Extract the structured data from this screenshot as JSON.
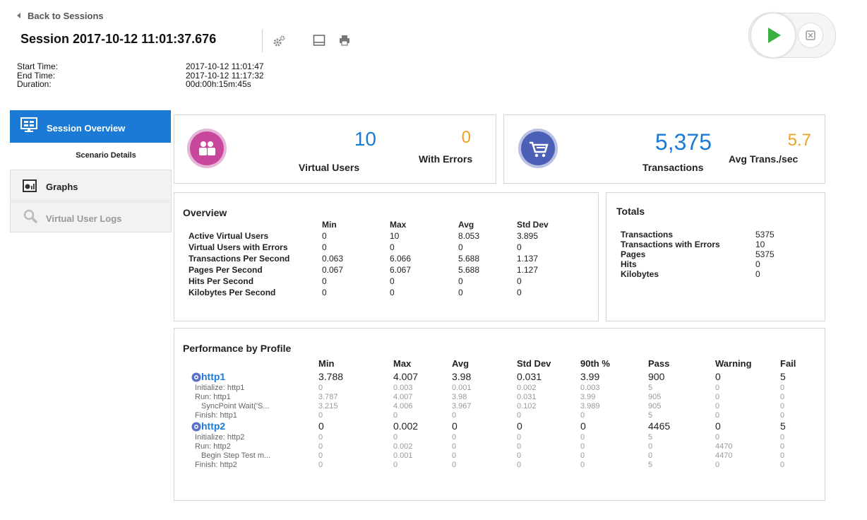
{
  "header": {
    "back_label": "Back to Sessions",
    "title": "Session 2017-10-12 11:01:37.676",
    "meta_labels": [
      "Start Time:",
      "End Time:",
      "Duration:"
    ],
    "meta_values": [
      "2017-10-12 11:01:47",
      "2017-10-12 11:17:32",
      "00d:00h:15m:45s"
    ]
  },
  "nav": {
    "session_overview": "Session Overview",
    "scenario_details": "Scenario Details",
    "graphs": "Graphs",
    "virtual_user_logs": "Virtual User Logs"
  },
  "kpi": {
    "virtual_users_value": "10",
    "virtual_users_label": "Virtual Users",
    "with_errors_value": "0",
    "with_errors_label": "With Errors",
    "transactions_value": "5,375",
    "transactions_label": "Transactions",
    "avg_trans_value": "5.7",
    "avg_trans_label": "Avg Trans./sec"
  },
  "overview": {
    "title": "Overview",
    "headers": [
      "Min",
      "Max",
      "Avg",
      "Std Dev"
    ],
    "rows": [
      {
        "label": "Active Virtual Users",
        "vals": [
          "0",
          "10",
          "8.053",
          "3.895"
        ]
      },
      {
        "label": "Virtual Users with Errors",
        "vals": [
          "0",
          "0",
          "0",
          "0"
        ]
      },
      {
        "label": "Transactions Per Second",
        "vals": [
          "0.063",
          "6.066",
          "5.688",
          "1.137"
        ]
      },
      {
        "label": "Pages Per Second",
        "vals": [
          "0.067",
          "6.067",
          "5.688",
          "1.127"
        ]
      },
      {
        "label": "Hits Per Second",
        "vals": [
          "0",
          "0",
          "0",
          "0"
        ]
      },
      {
        "label": "Kilobytes Per Second",
        "vals": [
          "0",
          "0",
          "0",
          "0"
        ]
      }
    ]
  },
  "totals": {
    "title": "Totals",
    "rows": [
      {
        "label": "Transactions",
        "value": "5375"
      },
      {
        "label": "Transactions with Errors",
        "value": "10"
      },
      {
        "label": "Pages",
        "value": "5375"
      },
      {
        "label": "Hits",
        "value": "0"
      },
      {
        "label": "Kilobytes",
        "value": "0"
      }
    ]
  },
  "performance": {
    "title": "Performance by Profile",
    "headers": [
      "Min",
      "Max",
      "Avg",
      "Std Dev",
      "90th %",
      "Pass",
      "Warning",
      "Fail"
    ],
    "rows": [
      {
        "kind": "profile",
        "label": "http1",
        "vals": [
          "3.788",
          "4.007",
          "3.98",
          "0.031",
          "3.99",
          "900",
          "0",
          "5"
        ]
      },
      {
        "kind": "sub",
        "label": "Initialize: http1",
        "vals": [
          "0",
          "0.003",
          "0.001",
          "0.002",
          "0.003",
          "5",
          "0",
          "0"
        ]
      },
      {
        "kind": "sub",
        "label": "Run: http1",
        "vals": [
          "3.787",
          "4.007",
          "3.98",
          "0.031",
          "3.99",
          "905",
          "0",
          "0"
        ]
      },
      {
        "kind": "subsub",
        "label": "SyncPoint Wait('S...",
        "vals": [
          "3.215",
          "4.006",
          "3.967",
          "0.102",
          "3.989",
          "905",
          "0",
          "0"
        ]
      },
      {
        "kind": "sub",
        "label": "Finish: http1",
        "vals": [
          "0",
          "0",
          "0",
          "0",
          "0",
          "5",
          "0",
          "0"
        ]
      },
      {
        "kind": "profile",
        "label": "http2",
        "vals": [
          "0",
          "0.002",
          "0",
          "0",
          "0",
          "4465",
          "0",
          "5"
        ]
      },
      {
        "kind": "sub",
        "label": "Initialize: http2",
        "vals": [
          "0",
          "0",
          "0",
          "0",
          "0",
          "5",
          "0",
          "0"
        ]
      },
      {
        "kind": "sub",
        "label": "Run: http2",
        "vals": [
          "0",
          "0.002",
          "0",
          "0",
          "0",
          "0",
          "4470",
          "0"
        ]
      },
      {
        "kind": "subsub",
        "label": "Begin Step Test m...",
        "vals": [
          "0",
          "0.001",
          "0",
          "0",
          "0",
          "0",
          "4470",
          "0"
        ]
      },
      {
        "kind": "sub",
        "label": "Finish: http2",
        "vals": [
          "0",
          "0",
          "0",
          "0",
          "0",
          "5",
          "0",
          "0"
        ]
      }
    ]
  },
  "colors": {
    "accent": "#1a7ad6",
    "orange": "#f0a020",
    "users_icon": "#c8479c",
    "cart_icon": "#4a5fb5",
    "play": "#3cb043"
  },
  "icons": [
    "back-arrow-icon",
    "settings-icon",
    "layout-icon",
    "print-icon",
    "play-icon",
    "stop-icon",
    "users-icon",
    "cart-icon",
    "monitor-icon",
    "graphs-icon",
    "search-icon",
    "profile-icon"
  ]
}
